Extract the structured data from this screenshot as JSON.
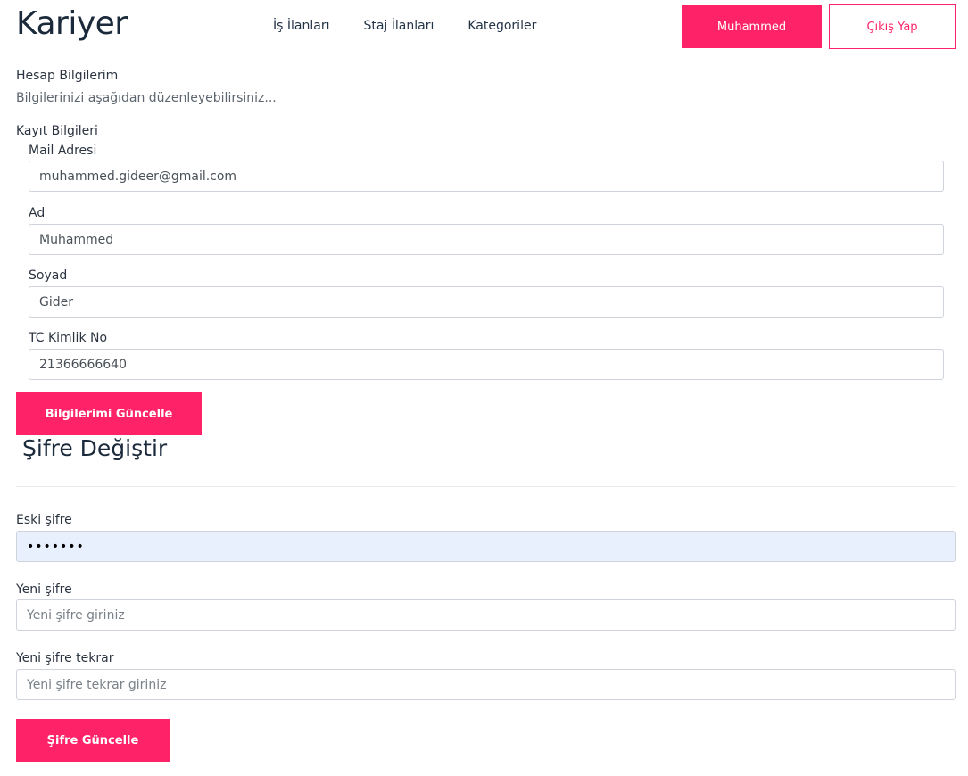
{
  "header": {
    "logo": "Kariyer",
    "nav": [
      "İş İlanları",
      "Staj İlanları",
      "Kategoriler"
    ],
    "user_button": "Muhammed",
    "logout_button": "Çıkış Yap"
  },
  "account": {
    "title": "Hesap Bilgilerim",
    "subtitle": "Bilgilerinizi aşağıdan düzenleyebilirsiniz...",
    "section_label": "Kayıt Bilgileri",
    "fields": [
      {
        "label": "Mail Adresi",
        "value": "muhammed.gideer@gmail.com"
      },
      {
        "label": "Ad",
        "value": "Muhammed"
      },
      {
        "label": "Soyad",
        "value": "Gider"
      },
      {
        "label": "TC Kimlik No",
        "value": "21366666640"
      }
    ],
    "update_button": "Bilgilerimi Güncelle"
  },
  "password": {
    "title": "Şifre Değiştir",
    "old_label": "Eski şifre",
    "old_value": "•••••••",
    "new_label": "Yeni şifre",
    "new_placeholder": "Yeni şifre giriniz",
    "repeat_label": "Yeni şifre tekrar",
    "repeat_placeholder": "Yeni şifre tekrar giriniz",
    "update_button": "Şifre Güncelle"
  },
  "colors": {
    "accent": "#fe2368",
    "autofill_bg": "#e8f0fe"
  }
}
